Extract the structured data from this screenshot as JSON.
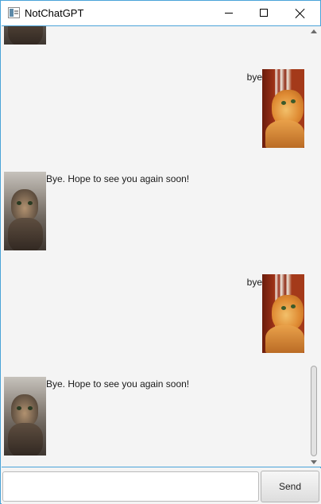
{
  "window": {
    "title": "NotChatGPT",
    "icon": "app-window-icon"
  },
  "titlebar_controls": [
    "minimize-icon",
    "maximize-icon",
    "close-icon"
  ],
  "dialog": [
    {
      "speaker": "duke",
      "text": "",
      "avatar": "tabby-cat"
    },
    {
      "speaker": "user",
      "text": "bye",
      "avatar": "orange-cat"
    },
    {
      "speaker": "duke",
      "text": "Bye. Hope to see you again soon!",
      "avatar": "tabby-cat"
    },
    {
      "speaker": "user",
      "text": "bye",
      "avatar": "orange-cat"
    },
    {
      "speaker": "duke",
      "text": "Bye. Hope to see you again soon!",
      "avatar": "tabby-cat"
    }
  ],
  "input": {
    "value": "",
    "placeholder": ""
  },
  "send_label": "Send"
}
